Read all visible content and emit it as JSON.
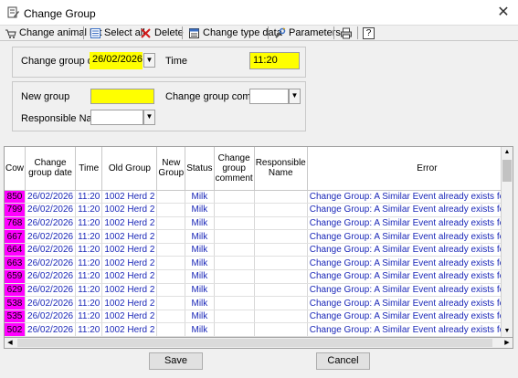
{
  "window": {
    "title": "Change Group",
    "close_glyph": "✕"
  },
  "toolbar": {
    "change_animal_list": "Change animal list",
    "select_all": "Select all",
    "delete": "Delete",
    "change_type_data": "Change type data",
    "parameters": "Parameters",
    "help": "?"
  },
  "form": {
    "change_group_date_label": "Change group date",
    "change_group_date_value": "26/02/2026",
    "time_label": "Time",
    "time_value": "11:20",
    "new_group_label": "New group",
    "new_group_value": "",
    "change_group_comment_label": "Change group comment",
    "change_group_comment_value": "",
    "responsible_name_label": "Responsible Name",
    "responsible_name_value": ""
  },
  "grid": {
    "headers": {
      "cow": "Cow",
      "change_group_date": "Change group date",
      "time": "Time",
      "old_group": "Old Group",
      "new_group": "New Group",
      "status": "Status",
      "change_group_comment": "Change group comment",
      "responsible_name": "Responsible Name",
      "error": "Error"
    },
    "rows": [
      {
        "cow": "850",
        "date": "26/02/2026",
        "time": "11:20",
        "old_group": "1002 Herd 2",
        "new_group": "",
        "status": "Milk",
        "comment": "",
        "responsible": "",
        "error": "Change Group: A Similar Event already exists for this date"
      },
      {
        "cow": "799",
        "date": "26/02/2026",
        "time": "11:20",
        "old_group": "1002 Herd 2",
        "new_group": "",
        "status": "Milk",
        "comment": "",
        "responsible": "",
        "error": "Change Group: A Similar Event already exists for this date"
      },
      {
        "cow": "768",
        "date": "26/02/2026",
        "time": "11:20",
        "old_group": "1002 Herd 2",
        "new_group": "",
        "status": "Milk",
        "comment": "",
        "responsible": "",
        "error": "Change Group: A Similar Event already exists for this date"
      },
      {
        "cow": "667",
        "date": "26/02/2026",
        "time": "11:20",
        "old_group": "1002 Herd 2",
        "new_group": "",
        "status": "Milk",
        "comment": "",
        "responsible": "",
        "error": "Change Group: A Similar Event already exists for this date"
      },
      {
        "cow": "664",
        "date": "26/02/2026",
        "time": "11:20",
        "old_group": "1002 Herd 2",
        "new_group": "",
        "status": "Milk",
        "comment": "",
        "responsible": "",
        "error": "Change Group: A Similar Event already exists for this date"
      },
      {
        "cow": "663",
        "date": "26/02/2026",
        "time": "11:20",
        "old_group": "1002 Herd 2",
        "new_group": "",
        "status": "Milk",
        "comment": "",
        "responsible": "",
        "error": "Change Group: A Similar Event already exists for this date"
      },
      {
        "cow": "659",
        "date": "26/02/2026",
        "time": "11:20",
        "old_group": "1002 Herd 2",
        "new_group": "",
        "status": "Milk",
        "comment": "",
        "responsible": "",
        "error": "Change Group: A Similar Event already exists for this date"
      },
      {
        "cow": "629",
        "date": "26/02/2026",
        "time": "11:20",
        "old_group": "1002 Herd 2",
        "new_group": "",
        "status": "Milk",
        "comment": "",
        "responsible": "",
        "error": "Change Group: A Similar Event already exists for this date"
      },
      {
        "cow": "538",
        "date": "26/02/2026",
        "time": "11:20",
        "old_group": "1002 Herd 2",
        "new_group": "",
        "status": "Milk",
        "comment": "",
        "responsible": "",
        "error": "Change Group: A Similar Event already exists for this date"
      },
      {
        "cow": "535",
        "date": "26/02/2026",
        "time": "11:20",
        "old_group": "1002 Herd 2",
        "new_group": "",
        "status": "Milk",
        "comment": "",
        "responsible": "",
        "error": "Change Group: A Similar Event already exists for this date"
      },
      {
        "cow": "502",
        "date": "26/02/2026",
        "time": "11:20",
        "old_group": "1002 Herd 2",
        "new_group": "",
        "status": "Milk",
        "comment": "",
        "responsible": "",
        "error": "Change Group: A Similar Event already exists for this date"
      }
    ]
  },
  "buttons": {
    "save": "Save",
    "cancel": "Cancel"
  },
  "colors": {
    "cow_highlight": "#ff00ff",
    "required_field": "#ffff00",
    "row_text": "#1a27b8"
  },
  "icons": [
    "app-icon",
    "close-icon",
    "animal-list-icon",
    "select-all-icon",
    "delete-icon",
    "change-type-data-icon",
    "parameters-icon",
    "print-icon",
    "help-icon",
    "chevron-down-icon"
  ]
}
